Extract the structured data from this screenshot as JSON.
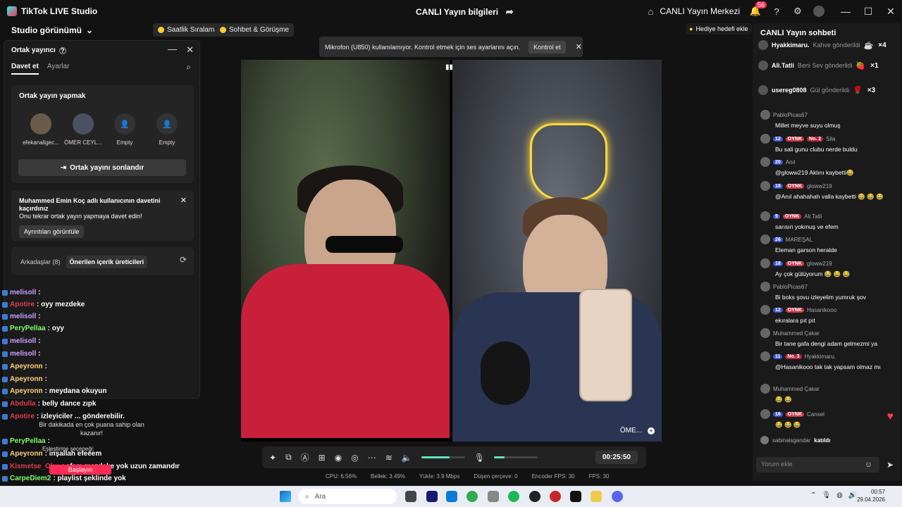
{
  "titlebar": {
    "app_name": "TikTok LIVE Studio",
    "center_title": "CANLI Yayın bilgileri",
    "live_center": "CANLI Yayın Merkezi",
    "notif_count": "56"
  },
  "toolbar": {
    "studio_view": "Studio görünümü",
    "pill1": "Saatlik Sıralama",
    "pill2": "Sohbet & Görüşme",
    "gift_goal": "Hediye hedefi ekle"
  },
  "guest_panel": {
    "title": "Ortak yayıncı",
    "tab_invite": "Davet et",
    "tab_settings": "Ayarlar",
    "card_title": "Ortak yayın yapmak",
    "slots": [
      "efekanaligec...",
      "ÖMER CEYL...",
      "Empty",
      "Empty"
    ],
    "end_button": "Ortak yayını sonlandır",
    "notice_bold": "Muhammed Emin Koç adlı kullanıcının davetini kaçırdınız",
    "notice_text": "Onu tekrar ortak yayın yapmaya davet edin!",
    "details_button": "Ayrıntıları görüntüle",
    "friends": "Arkadaşlar (8)",
    "suggested": "Önerilen içerik üreticileri"
  },
  "overlay_chat": [
    {
      "user": "melisoll",
      "text": ":",
      "color": "#c9a0ff"
    },
    {
      "user": "Apotire",
      "text": ": oyy mezdeke",
      "color": "#e03c4b"
    },
    {
      "user": "melisoll",
      "text": ":",
      "color": "#c9a0ff"
    },
    {
      "user": "PeryPellaa",
      "text": ": oyy",
      "color": "#7dff6a"
    },
    {
      "user": "melisoll",
      "text": ":",
      "color": "#c9a0ff"
    },
    {
      "user": "melisoll",
      "text": ":",
      "color": "#c9a0ff"
    },
    {
      "user": "Apeyronn",
      "text": ":",
      "color": "#ffd27d"
    },
    {
      "user": "Apeyronn",
      "text": ":",
      "color": "#ffd27d"
    },
    {
      "user": "Apeyronn",
      "text": ": meydana okuyun",
      "color": "#ffd27d"
    },
    {
      "user": "Abdulla",
      "text": ": belly dance zıpk",
      "color": "#e03c4b"
    },
    {
      "user": "Apotire",
      "text": ": izleyiciler ... gönderebilir.",
      "color": "#e03c4b"
    },
    {
      "user": "PeryPellaa",
      "text": ":",
      "color": "#7dff6a"
    },
    {
      "user": "Apeyronn",
      "text": ": inşallah efeeem",
      "color": "#ffd27d"
    },
    {
      "user": "Kismetse_Olur",
      "text": ": efem mezdeke yok uzun zamandır",
      "color": "#e03c4b"
    },
    {
      "user": "CarpeDiem2",
      "text": ": playlist şeklinde yok",
      "color": "#7dff6a"
    }
  ],
  "overlay_misc": {
    "rank_note": "Bir dakikada en çok puana sahip olan kazanır!",
    "match_label": "Eşleştirme seçeneği:",
    "start": "Başlayın"
  },
  "toast": {
    "text": "Mikrofon (U850) kullanılamıyor. Kontrol etmek için ses ayarlarını açın.",
    "button": "Kontrol et"
  },
  "stream": {
    "right_label": "ÖME..."
  },
  "controls": {
    "timer": "00:25:50",
    "volume_level": 0.65,
    "mic_level": 0.25
  },
  "stats": {
    "cpu": "CPU: 6.56%",
    "mem": "Bellek: 3.49%",
    "upload": "Yükle: 3.9 Mbps",
    "dropped": "Düşen çerçeve: 0",
    "encoder": "Encoder FPS: 30",
    "fps": "FPS: 30"
  },
  "chat": {
    "title": "CANLI Yayın sohbeti",
    "gifts": [
      {
        "user": "Hyakkimaru.",
        "text": "Kahve gönderildi",
        "count": "×4",
        "icon": "☕"
      },
      {
        "user": "Ali.Tatli",
        "text": "Beni Sev gönderildi",
        "count": "×1",
        "icon": "🍓"
      },
      {
        "user": "usereg0808",
        "text": "Gül gönderildi",
        "count": "×3",
        "icon": "🌹"
      }
    ],
    "messages": [
      {
        "user": "PabloPicas67",
        "badges": [],
        "text": "Millet meyve suyu olmuş"
      },
      {
        "user": "Sila",
        "badges": [
          "12",
          "OYNK",
          "No. 2"
        ],
        "text": "Bu sali gunu clubu nerde buldu"
      },
      {
        "user": "Anıl",
        "badges": [
          "20"
        ],
        "text": "@gloww219 Aklını kaybetti😂"
      },
      {
        "user": "gloww219",
        "badges": [
          "18",
          "OYNK"
        ],
        "text": "@Anıl ahahahah valla kaybetti 😂 😂 😂"
      },
      {
        "user": "Ali.Tatli",
        "badges": [
          "9",
          "OYNK"
        ],
        "text": "sarısın yokmuş ve efem"
      },
      {
        "user": "MAREŞAL",
        "badges": [
          "26"
        ],
        "text": "Eleman garson heralde"
      },
      {
        "user": "gloww219",
        "badges": [
          "18",
          "OYNK"
        ],
        "text": "Ay çok gülüyorum 😂 😂 😂"
      },
      {
        "user": "PabloPicas67",
        "badges": [],
        "text": "Bi boks şovu izleyelim yumruk şov"
      },
      {
        "user": "Hasanikooo",
        "badges": [
          "12",
          "OYNK"
        ],
        "text": "ekıralara pıt pıt"
      },
      {
        "user": "Muhammed Çakar",
        "badges": [],
        "text": "Bir tane gafa dengi adam gelmezmi ya"
      },
      {
        "user": "Hyakkimaru.",
        "badges": [
          "11",
          "No. 3"
        ],
        "text": "@Hasanikooo tak tak yapsam olmaz mı"
      },
      {
        "user": "Muhammed Çakar",
        "badges": [],
        "text": "😂 😂"
      },
      {
        "user": "Cansel",
        "badges": [
          "16",
          "OYNK"
        ],
        "text": "😂 😂 😂"
      }
    ],
    "join_user": "sabinaisgandar",
    "join_text": "katıldı",
    "comment_placeholder": "Yorum ekle"
  },
  "taskbar": {
    "search": "Ara",
    "time": "00:57",
    "date": "29.04.2026"
  }
}
